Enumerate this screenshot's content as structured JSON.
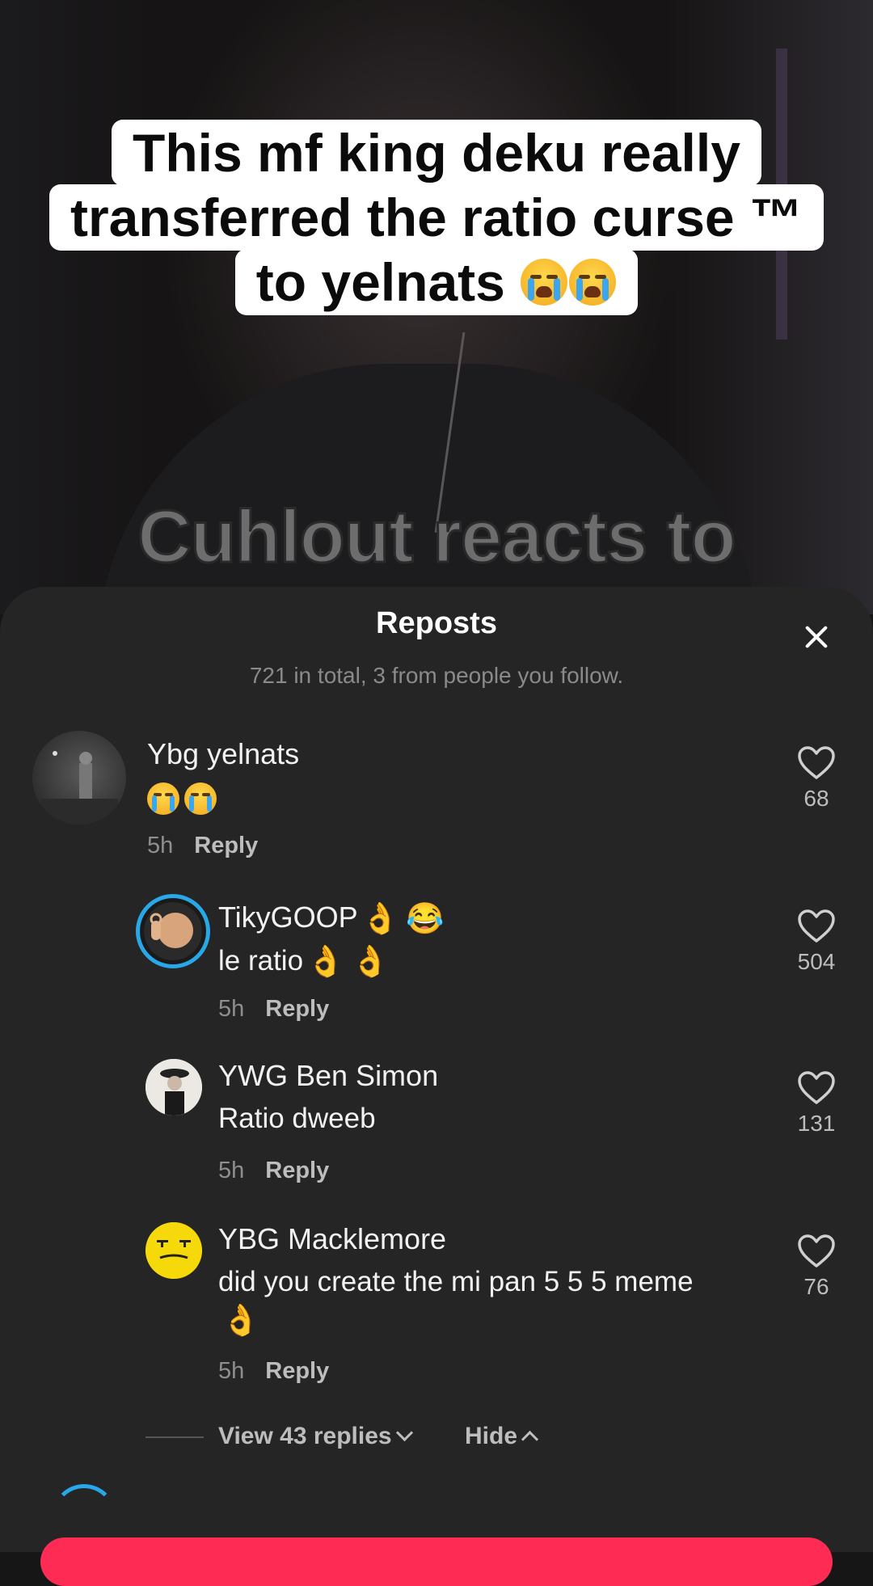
{
  "video": {
    "caption_lines": [
      "This mf king deku really",
      "transferred the ratio curse ™",
      "to yelnats"
    ],
    "overlay_text": "Cuhlout reacts to"
  },
  "sheet": {
    "title": "Reposts",
    "subtitle": "721 in total, 3 from people you follow."
  },
  "comments": [
    {
      "name": "Ybg yelnats",
      "text": "",
      "time": "5h",
      "reply": "Reply",
      "likes": "68",
      "avatar_color": "#3b3b3b"
    },
    {
      "name": "TikyGOOP",
      "text": "le ratio",
      "time": "5h",
      "reply": "Reply",
      "likes": "504",
      "avatar_color": "#caa27a",
      "ring_color": "#29a8e8"
    },
    {
      "name": "YWG Ben Simon",
      "text": "Ratio dweeb",
      "time": "5h",
      "reply": "Reply",
      "likes": "131",
      "avatar_color": "#e8e4e0"
    },
    {
      "name": "YBG Macklemore",
      "text": "did you create the mi pan 5 5 5 meme",
      "time": "5h",
      "reply": "Reply",
      "likes": "76",
      "avatar_color": "#f5d90a"
    }
  ],
  "thread": {
    "view_replies": "View 43 replies",
    "hide": "Hide"
  },
  "colors": {
    "sheet_bg": "#252526",
    "accent": "#fe2c55",
    "ring": "#29a8e8"
  }
}
